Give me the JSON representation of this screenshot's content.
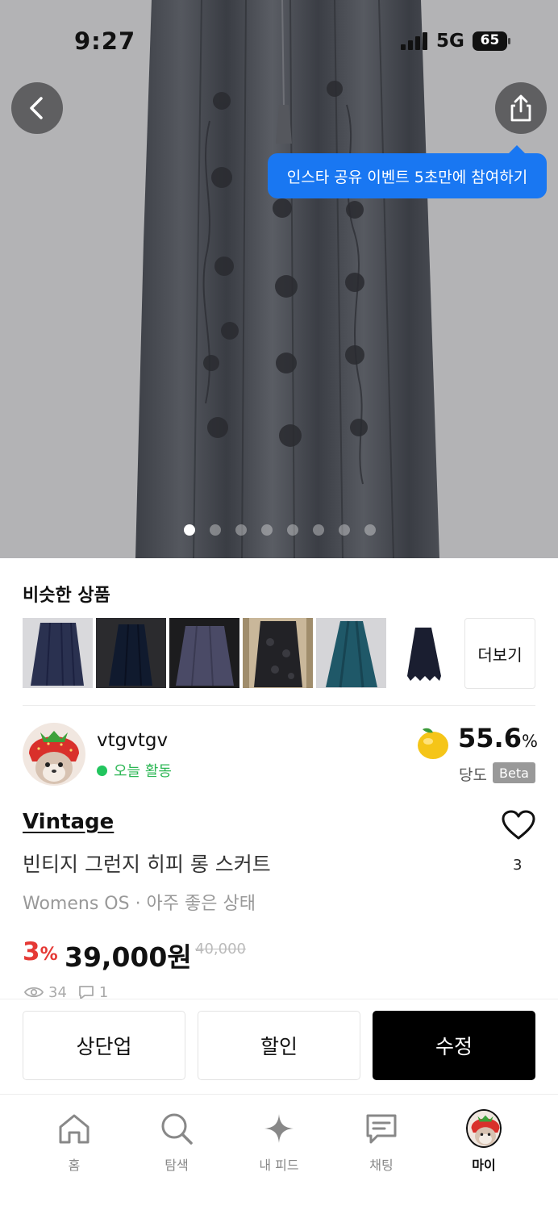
{
  "status_bar": {
    "time": "9:27",
    "network": "5G",
    "battery": "65"
  },
  "tooltip": {
    "text": "인스타 공유 이벤트 5초만에 참여하기"
  },
  "carousel": {
    "total": 8,
    "active_index": 0
  },
  "similar": {
    "title": "비슷한 상품",
    "more_label": "더보기",
    "thumbnails": [
      {
        "icon": "skirt-thumbnail",
        "color": "#2a3150"
      },
      {
        "icon": "skirt-thumbnail",
        "color": "#101a2e"
      },
      {
        "icon": "skirt-thumbnail",
        "color": "#4a4a66"
      },
      {
        "icon": "skirt-thumbnail",
        "color": "#222226"
      },
      {
        "icon": "skirt-thumbnail",
        "color": "#1f5868"
      },
      {
        "icon": "skirt-thumbnail",
        "color": "#1a1e30"
      }
    ]
  },
  "seller": {
    "name": "vtgvtgv",
    "activity": "오늘 활동",
    "score": "55.6",
    "score_unit": "%",
    "score_label": "당도",
    "beta_badge": "Beta"
  },
  "product": {
    "brand": "Vintage",
    "title": "빈티지 그런지 히피 롱 스커트",
    "subtitle": "Womens OS · 아주 좋은 상태",
    "discount_value": "3",
    "discount_unit": "%",
    "price": "39,000원",
    "original_price": "40,000",
    "likes": "3",
    "views": "34",
    "comments": "1"
  },
  "actions": {
    "bump": "상단업",
    "discount": "할인",
    "edit": "수정"
  },
  "tabs": [
    {
      "label": "홈",
      "icon": "home-icon"
    },
    {
      "label": "탐색",
      "icon": "search-icon"
    },
    {
      "label": "내 피드",
      "icon": "sparkle-icon"
    },
    {
      "label": "채팅",
      "icon": "chat-icon"
    },
    {
      "label": "마이",
      "icon": "avatar-icon"
    }
  ],
  "colors": {
    "accent_blue": "#1977f2",
    "discount_red": "#e53935",
    "online_green": "#22c55e",
    "lemon_yellow": "#f5c518"
  }
}
